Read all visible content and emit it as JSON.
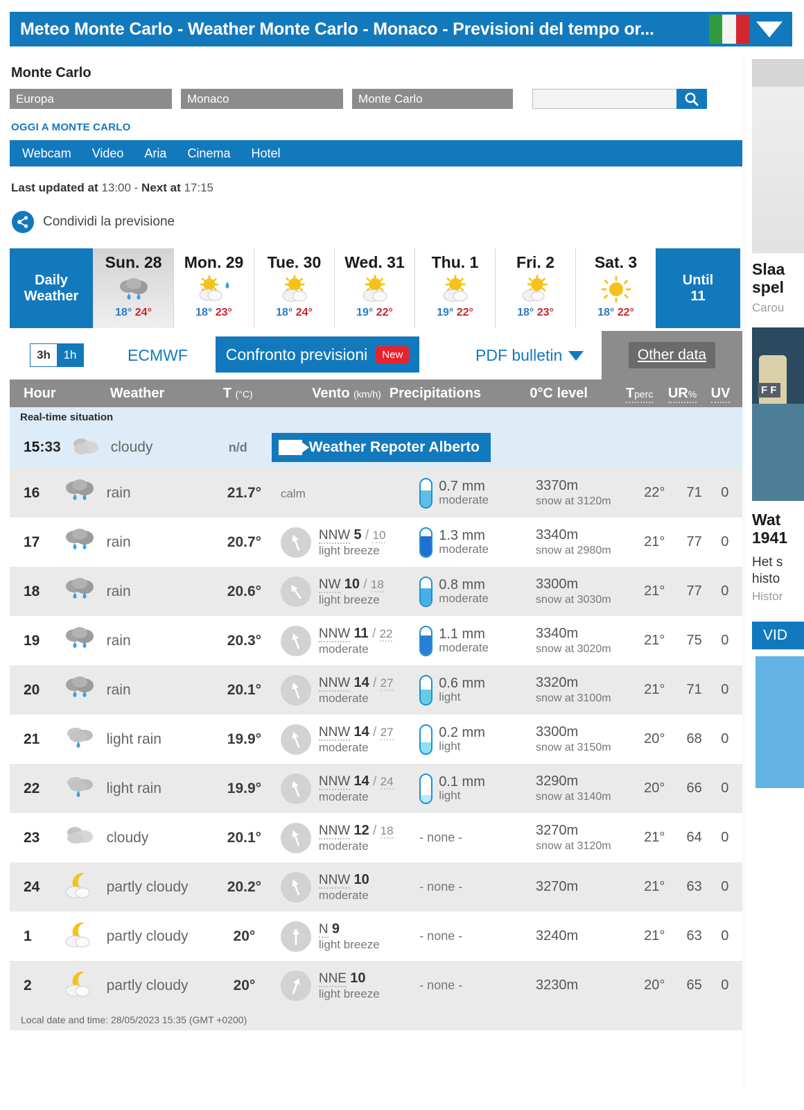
{
  "titlebar": {
    "title": "Meteo Monte Carlo - Weather Monte Carlo - Monaco - Previsioni del tempo or...",
    "flag_icon": "italian-flag-icon",
    "caret_icon": "chevron-down-icon",
    "accent_color": "#1379bd"
  },
  "header": {
    "city": "Monte Carlo",
    "breadcrumbs": [
      "Europa",
      "Monaco",
      "Monte Carlo"
    ],
    "search": {
      "value": "",
      "placeholder": "",
      "icon": "search-icon"
    },
    "today_link": "OGGI A MONTE CARLO"
  },
  "navbar": {
    "items": [
      "Webcam",
      "Video",
      "Aria",
      "Cinema",
      "Hotel"
    ]
  },
  "update": {
    "label_last": "Last updated at",
    "time_last": "13:00",
    "separator": "-",
    "label_next": "Next at",
    "time_next": "17:15"
  },
  "share": {
    "label": "Condividi la previsione",
    "icon": "share-icon"
  },
  "daily": {
    "head_label": "Daily\nWeather",
    "head_line1": "Daily",
    "head_line2": "Weather",
    "until_line1": "Until",
    "until_line2": "11",
    "days": [
      {
        "name": "Sun. 28",
        "icon": "rain-icon",
        "low": "18°",
        "high": "24°",
        "active": true
      },
      {
        "name": "Mon. 29",
        "icon": "sun-cloud-drop-icon",
        "low": "18°",
        "high": "23°",
        "active": false
      },
      {
        "name": "Tue. 30",
        "icon": "sun-cloud-icon",
        "low": "18°",
        "high": "24°",
        "active": false
      },
      {
        "name": "Wed. 31",
        "icon": "sun-cloud-icon",
        "low": "19°",
        "high": "22°",
        "active": false
      },
      {
        "name": "Thu. 1",
        "icon": "sun-cloud-icon",
        "low": "19°",
        "high": "22°",
        "active": false
      },
      {
        "name": "Fri. 2",
        "icon": "sun-cloud-icon",
        "low": "18°",
        "high": "23°",
        "active": false
      },
      {
        "name": "Sat. 3",
        "icon": "sun-icon",
        "low": "18°",
        "high": "22°",
        "active": false
      }
    ]
  },
  "toolbar": {
    "interval_3h": "3h",
    "interval_1h": "1h",
    "interval_selected": "1h",
    "model": "ECMWF",
    "compare": "Confronto previsioni",
    "compare_badge": "New",
    "pdf": "PDF bulletin",
    "pdf_caret_icon": "chevron-down-icon",
    "other_data": "Other data"
  },
  "table": {
    "columns": {
      "hour": "Hour",
      "weather": "Weather",
      "temp": "T",
      "temp_unit": "(°C)",
      "wind": "Vento",
      "wind_unit": "(km/h)",
      "precip": "Precipitations",
      "zero_level": "0°C level",
      "tperc": "T",
      "tperc_sub": "perc",
      "ur": "UR",
      "ur_sub": "%",
      "uv": "UV"
    },
    "realtime_band": "Real-time situation",
    "realtime": {
      "hour_bold": "15",
      "hour_rest": ":33",
      "icon": "cloudy-icon",
      "desc": "cloudy",
      "temp": "n/d",
      "reporter": "Weather Repoter Alberto",
      "reporter_icon": "webcam-icon"
    },
    "rows": [
      {
        "hour": "16",
        "icon": "rain-icon",
        "desc": "rain",
        "temp": "21.7°",
        "wind_dir": "",
        "wind_speed": "",
        "wind_gust": "",
        "wind_desc": "calm",
        "wind_calm": "calm",
        "wind_angle": null,
        "precip_mm": "0.7 mm",
        "precip_label": "moderate",
        "precip_fill": 60,
        "precip_color": "#5bc0e8",
        "zero": "3370m",
        "snow": "snow at 3120m",
        "tperc": "22°",
        "ur": "71",
        "uv": "0"
      },
      {
        "hour": "17",
        "icon": "rain-icon",
        "desc": "rain",
        "temp": "20.7°",
        "wind_dir": "NNW",
        "wind_speed": "5",
        "wind_gust": "10",
        "wind_desc": "light breeze",
        "wind_calm": "",
        "wind_angle": 160,
        "precip_mm": "1.3 mm",
        "precip_label": "moderate",
        "precip_fill": 72,
        "precip_color": "#1f6fd0",
        "zero": "3340m",
        "snow": "snow at 2980m",
        "tperc": "21°",
        "ur": "77",
        "uv": "0"
      },
      {
        "hour": "18",
        "icon": "rain-icon",
        "desc": "rain",
        "temp": "20.6°",
        "wind_dir": "NW",
        "wind_speed": "10",
        "wind_gust": "18",
        "wind_desc": "light breeze",
        "wind_calm": "",
        "wind_angle": 145,
        "precip_mm": "0.8 mm",
        "precip_label": "moderate",
        "precip_fill": 62,
        "precip_color": "#45b0e4",
        "zero": "3300m",
        "snow": "snow at 3030m",
        "tperc": "21°",
        "ur": "77",
        "uv": "0"
      },
      {
        "hour": "19",
        "icon": "rain-icon",
        "desc": "rain",
        "temp": "20.3°",
        "wind_dir": "NNW",
        "wind_speed": "11",
        "wind_gust": "22",
        "wind_desc": "moderate",
        "wind_calm": "",
        "wind_angle": 160,
        "precip_mm": "1.1 mm",
        "precip_label": "moderate",
        "precip_fill": 68,
        "precip_color": "#2a7fd4",
        "zero": "3340m",
        "snow": "snow at 3020m",
        "tperc": "21°",
        "ur": "75",
        "uv": "0"
      },
      {
        "hour": "20",
        "icon": "rain-icon",
        "desc": "rain",
        "temp": "20.1°",
        "wind_dir": "NNW",
        "wind_speed": "14",
        "wind_gust": "27",
        "wind_desc": "moderate",
        "wind_calm": "",
        "wind_angle": 160,
        "precip_mm": "0.6 mm",
        "precip_label": "light",
        "precip_fill": 52,
        "precip_color": "#63cbe8",
        "zero": "3320m",
        "snow": "snow at 3100m",
        "tperc": "21°",
        "ur": "71",
        "uv": "0"
      },
      {
        "hour": "21",
        "icon": "light-rain-icon",
        "desc": "light rain",
        "temp": "19.9°",
        "wind_dir": "NNW",
        "wind_speed": "14",
        "wind_gust": "27",
        "wind_desc": "moderate",
        "wind_calm": "",
        "wind_angle": 160,
        "precip_mm": "0.2 mm",
        "precip_label": "light",
        "precip_fill": 40,
        "precip_color": "#8fe0f2",
        "zero": "3300m",
        "snow": "snow at 3150m",
        "tperc": "20°",
        "ur": "68",
        "uv": "0"
      },
      {
        "hour": "22",
        "icon": "light-rain-icon",
        "desc": "light rain",
        "temp": "19.9°",
        "wind_dir": "NNW",
        "wind_speed": "14",
        "wind_gust": "24",
        "wind_desc": "moderate",
        "wind_calm": "",
        "wind_angle": 160,
        "precip_mm": "0.1 mm",
        "precip_label": "light",
        "precip_fill": 26,
        "precip_color": "#b6ecf7",
        "zero": "3290m",
        "snow": "snow at 3140m",
        "tperc": "20°",
        "ur": "66",
        "uv": "0"
      },
      {
        "hour": "23",
        "icon": "cloudy-icon",
        "desc": "cloudy",
        "temp": "20.1°",
        "wind_dir": "NNW",
        "wind_speed": "12",
        "wind_gust": "18",
        "wind_desc": "moderate",
        "wind_calm": "",
        "wind_angle": 160,
        "precip_mm": "",
        "precip_label": "",
        "precip_fill": 0,
        "precip_color": "",
        "precip_none": "- none -",
        "zero": "3270m",
        "snow": "snow at 3120m",
        "tperc": "21°",
        "ur": "64",
        "uv": "0"
      },
      {
        "hour": "24",
        "icon": "moon-cloud-icon",
        "desc": "partly cloudy",
        "temp": "20.2°",
        "wind_dir": "NNW",
        "wind_speed": "10",
        "wind_gust": "",
        "wind_desc": "moderate",
        "wind_calm": "",
        "wind_angle": 160,
        "precip_mm": "",
        "precip_label": "",
        "precip_fill": 0,
        "precip_color": "",
        "precip_none": "- none -",
        "zero": "3270m",
        "snow": "",
        "tperc": "21°",
        "ur": "63",
        "uv": "0"
      },
      {
        "hour": "1",
        "icon": "moon-cloud-icon",
        "desc": "partly cloudy",
        "temp": "20°",
        "wind_dir": "N",
        "wind_speed": "9",
        "wind_gust": "",
        "wind_desc": "light breeze",
        "wind_calm": "",
        "wind_angle": 180,
        "precip_mm": "",
        "precip_label": "",
        "precip_fill": 0,
        "precip_color": "",
        "precip_none": "- none -",
        "zero": "3240m",
        "snow": "",
        "tperc": "21°",
        "ur": "63",
        "uv": "0"
      },
      {
        "hour": "2",
        "icon": "moon-cloud-icon",
        "desc": "partly cloudy",
        "temp": "20°",
        "wind_dir": "NNE",
        "wind_speed": "10",
        "wind_gust": "",
        "wind_desc": "light breeze",
        "wind_calm": "",
        "wind_angle": 200,
        "precip_mm": "",
        "precip_label": "",
        "precip_fill": 0,
        "precip_color": "",
        "precip_none": "- none -",
        "zero": "3230m",
        "snow": "",
        "tperc": "20°",
        "ur": "65",
        "uv": "0"
      }
    ],
    "footer": "Local date and time: 28/05/2023 15:35 (GMT +0200)"
  },
  "sidebar": {
    "card1_title": "Slaa\nspel",
    "card1_title_l1": "Slaa",
    "card1_title_l2": "spel",
    "card1_sub": "Carou",
    "card2_title_l1": "Wat",
    "card2_title_l2": "1941",
    "card2_body_l1": "Het s",
    "card2_body_l2": "histo",
    "card2_sub": "Histor",
    "map_label": "F F",
    "video_label": "VID"
  }
}
